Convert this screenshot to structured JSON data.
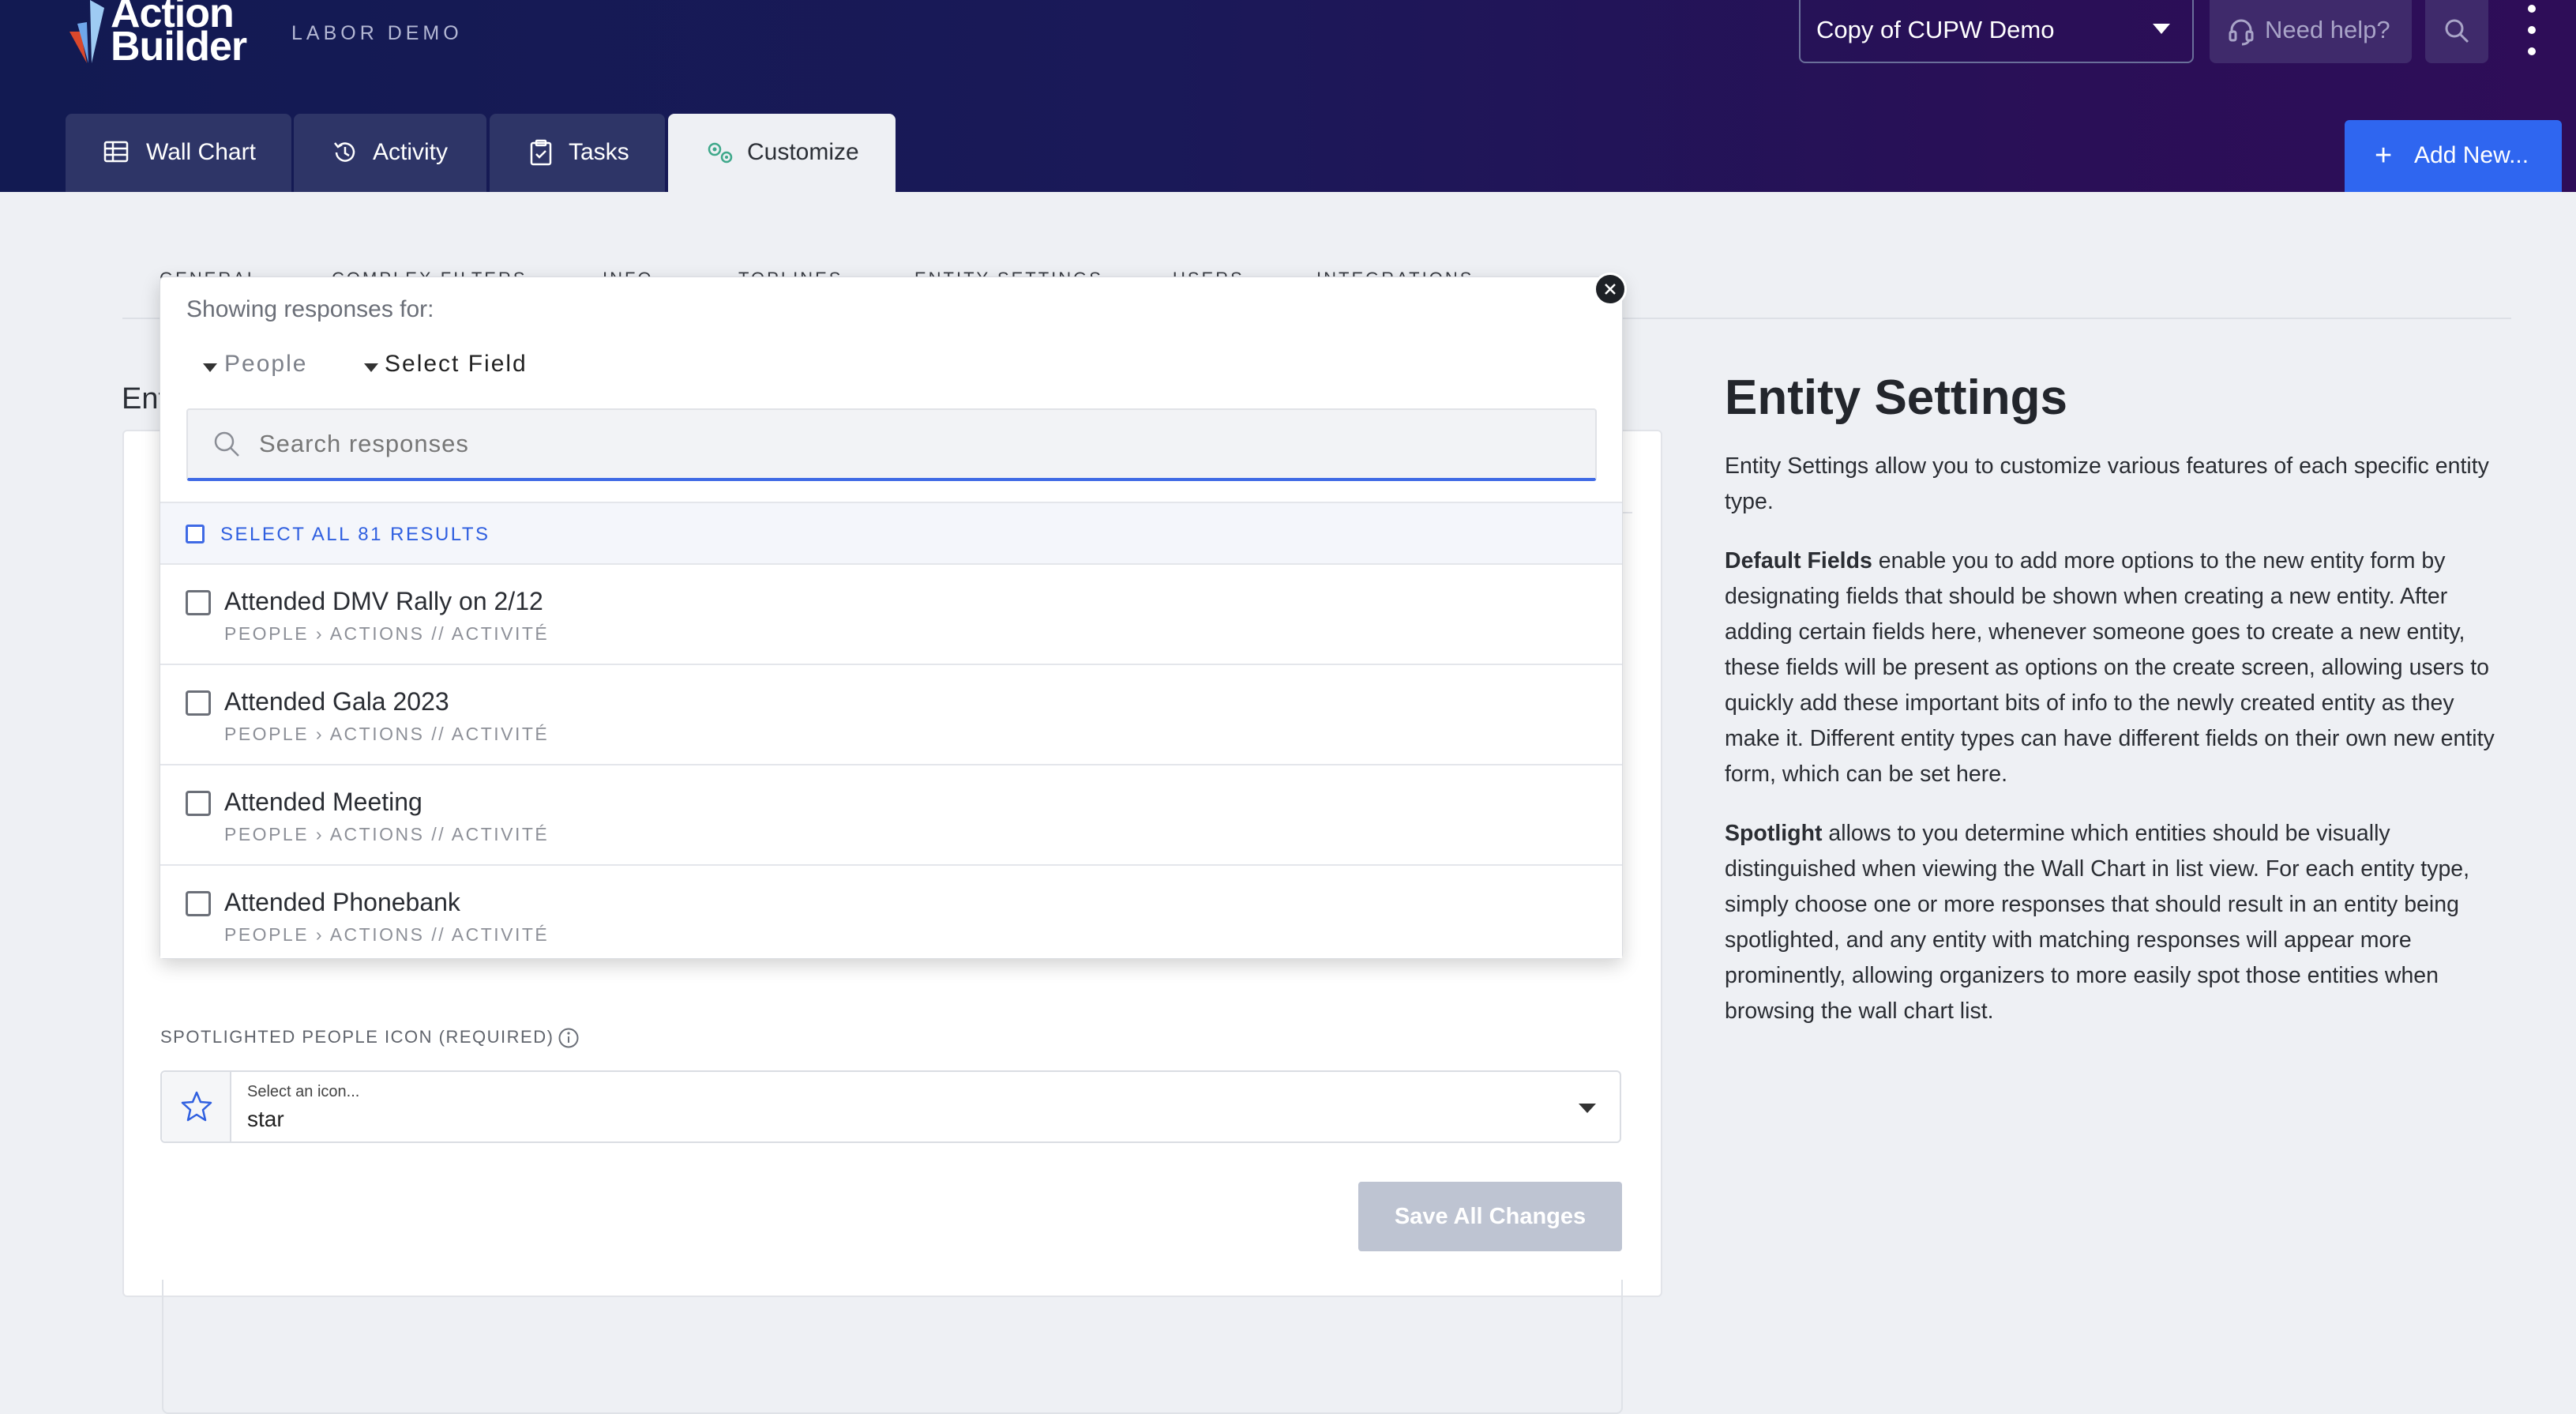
{
  "header": {
    "logo": {
      "line1": "Action",
      "line2": "Builder"
    },
    "workspace_label": "LABOR DEMO",
    "campaign_select": {
      "value": "Copy of CUPW Demo"
    },
    "help_button": {
      "label": "Need help?",
      "icon": "headset-icon"
    },
    "search_icon": "search-icon",
    "more_icon": "vertical-dots-icon"
  },
  "main_tabs": [
    {
      "label": "Wall Chart",
      "icon": "table-icon",
      "active": false
    },
    {
      "label": "Activity",
      "icon": "history-icon",
      "active": false
    },
    {
      "label": "Tasks",
      "icon": "clipboard-icon",
      "active": false
    },
    {
      "label": "Customize",
      "icon": "gears-icon",
      "active": true
    }
  ],
  "add_new_button": {
    "label": "Add New..."
  },
  "sub_tabs": [
    "GENERAL",
    "COMPLEX FILTERS",
    "INFO",
    "TOPLINES",
    "ENTITY SETTINGS",
    "USERS",
    "INTEGRATIONS"
  ],
  "page_heading": "Ent",
  "spotlight_icon": {
    "label": "SPOTLIGHTED PEOPLE ICON (REQUIRED)",
    "select_label": "Select an icon...",
    "value": "star"
  },
  "save_button": {
    "label": "Save All Changes"
  },
  "side_panel": {
    "title": "Entity Settings",
    "intro": "Entity Settings allow you to customize various features of each specific entity type.",
    "default_fields_term": "Default Fields",
    "default_fields_text": " enable you to add more options to the new entity form by designating fields that should be shown when creating a new entity. After adding certain fields here, whenever someone goes to create a new entity, these fields will be present as options on the create screen, allowing users to quickly add these important bits of info to the newly created entity as they make it. Different entity types can have different fields on their own new entity form, which can be set here.",
    "spotlight_term": "Spotlight",
    "spotlight_text": " allows to you determine which entities should be visually distinguished when viewing the Wall Chart in list view. For each entity type, simply choose one or more responses that should result in an entity being spotlighted, and any entity with matching responses will appear more prominently, allowing organizers to more easily spot those entities when browsing the wall chart list."
  },
  "response_picker": {
    "showing_label": "Showing responses for:",
    "entity_filter": "People",
    "field_filter": "Select Field",
    "search_placeholder": "Search responses",
    "search_value": "",
    "select_all_label": "SELECT ALL 81 RESULTS",
    "items": [
      {
        "name": "Attended DMV Rally on 2/12",
        "path": "PEOPLE › ACTIONS // ACTIVITÉ",
        "checked": false
      },
      {
        "name": "Attended Gala 2023",
        "path": "PEOPLE › ACTIONS // ACTIVITÉ",
        "checked": false
      },
      {
        "name": "Attended Meeting",
        "path": "PEOPLE › ACTIONS // ACTIVITÉ",
        "checked": false
      },
      {
        "name": "Attended Phonebank",
        "path": "PEOPLE › ACTIONS // ACTIVITÉ",
        "checked": false
      }
    ]
  },
  "colors": {
    "header_bg": "#1a1958",
    "accent_blue": "#2f66f0",
    "active_tab_bg": "#eef0f4"
  }
}
